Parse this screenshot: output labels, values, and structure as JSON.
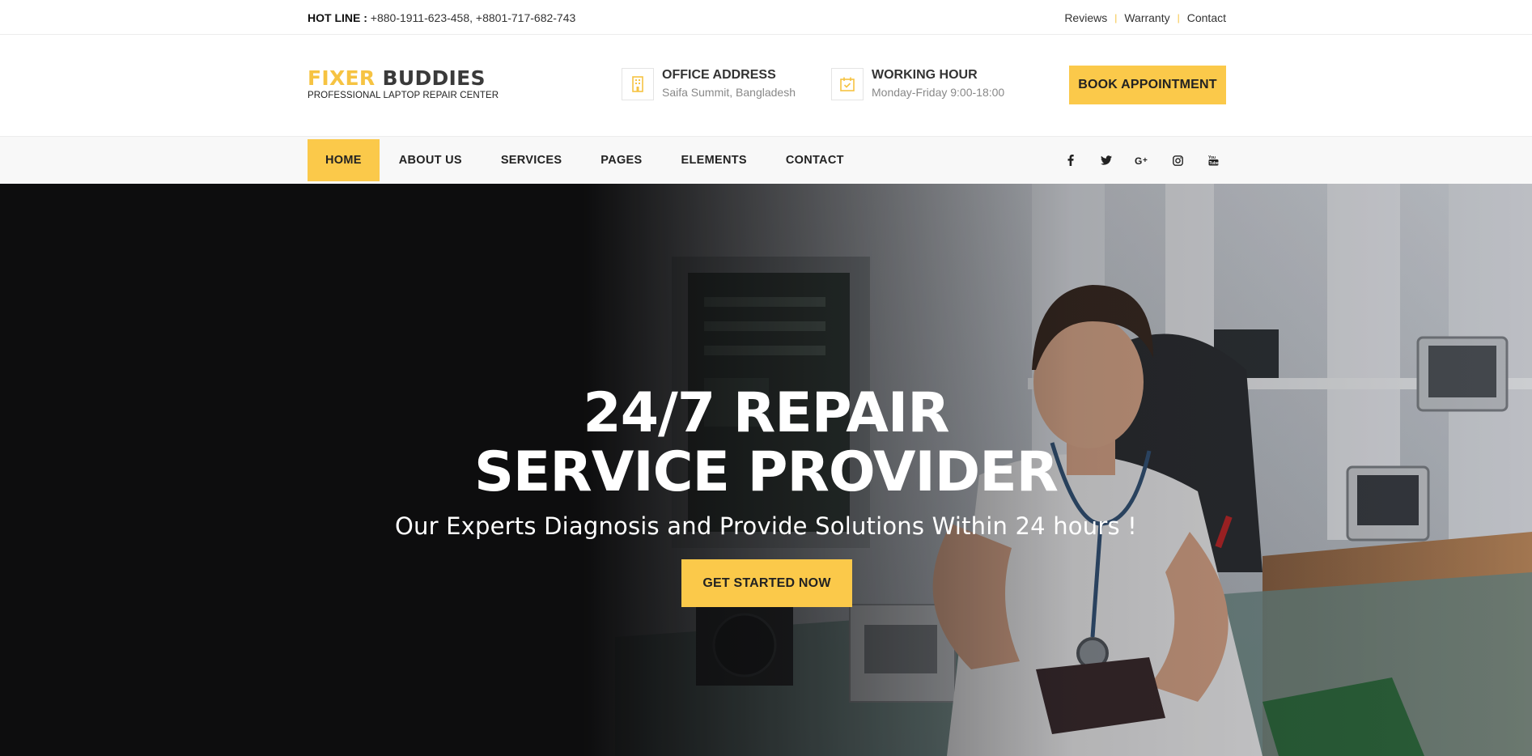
{
  "topbar": {
    "hotline_label": "HOT LINE :",
    "hotline_numbers": "+880-1911-623-458, +8801-717-682-743",
    "links": [
      "Reviews",
      "Warranty",
      "Contact"
    ]
  },
  "header": {
    "logo_word1": "FIXER",
    "logo_word2": "BUDDIES",
    "tagline": "PROFESSIONAL LAPTOP REPAIR CENTER",
    "office_title": "OFFICE ADDRESS",
    "office_value": "Saifa Summit, Bangladesh",
    "hours_title": "WORKING HOUR",
    "hours_value": "Monday-Friday 9:00-18:00",
    "book_label": "BOOK APPOINTMENT"
  },
  "nav": {
    "items": [
      "HOME",
      "ABOUT US",
      "SERVICES",
      "PAGES",
      "ELEMENTS",
      "CONTACT"
    ],
    "active": "HOME",
    "socials": [
      "facebook-icon",
      "twitter-icon",
      "google-plus-icon",
      "instagram-icon",
      "youtube-icon"
    ]
  },
  "hero": {
    "title_line1": "24/7 REPAIR",
    "title_line2": "SERVICE PROVIDER",
    "subtitle": "Our Experts Diagnosis and Provide Solutions Within 24 hours !",
    "cta_label": "GET STARTED NOW"
  },
  "colors": {
    "accent": "#fbc94a",
    "dark": "#0f0f10",
    "text": "#222222"
  }
}
